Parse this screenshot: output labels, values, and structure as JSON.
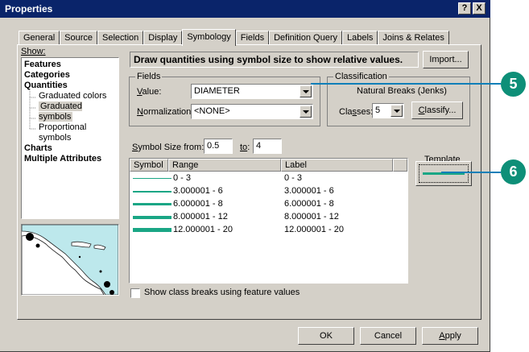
{
  "window": {
    "title": "Properties",
    "help_btn": "?",
    "close_btn": "X"
  },
  "tabs": [
    {
      "label": "General"
    },
    {
      "label": "Source"
    },
    {
      "label": "Selection"
    },
    {
      "label": "Display"
    },
    {
      "label": "Symbology"
    },
    {
      "label": "Fields"
    },
    {
      "label": "Definition Query"
    },
    {
      "label": "Labels"
    },
    {
      "label": "Joins & Relates"
    }
  ],
  "show": {
    "label": "Show:",
    "items": [
      {
        "label": "Features"
      },
      {
        "label": "Categories"
      },
      {
        "label": "Quantities"
      },
      {
        "label": "Graduated colors"
      },
      {
        "label": "Graduated symbols"
      },
      {
        "label": "Proportional symbols"
      },
      {
        "label": "Charts"
      },
      {
        "label": "Multiple Attributes"
      }
    ]
  },
  "description": "Draw quantities using symbol size to show relative values.",
  "import_label": "Import...",
  "fields": {
    "title": "Fields",
    "value_label": "Value:",
    "value": "DIAMETER",
    "normalization_label": "Normalization:",
    "normalization": "<NONE>"
  },
  "classification": {
    "title": "Classification",
    "method": "Natural Breaks (Jenks)",
    "classes_label": "Classes:",
    "classes": "5",
    "classify_label": "Classify..."
  },
  "symbol_size": {
    "from_label": "Symbol Size from:",
    "from": "0.5",
    "to_label": "to:",
    "to": "4"
  },
  "table": {
    "headers": [
      "Symbol",
      "Range",
      "Label"
    ],
    "rows": [
      {
        "range": "0 - 3",
        "label": "0 - 3"
      },
      {
        "range": "3.000001 - 6",
        "label": "3.000001 - 6"
      },
      {
        "range": "6.000001 - 8",
        "label": "6.000001 - 8"
      },
      {
        "range": "8.000001 - 12",
        "label": "8.000001 - 12"
      },
      {
        "range": "12.000001 - 20",
        "label": "12.000001 - 20"
      }
    ]
  },
  "template_label": "Template",
  "show_class_breaks": "Show class breaks using feature values",
  "buttons": {
    "ok": "OK",
    "cancel": "Cancel",
    "apply": "Apply"
  },
  "callouts": [
    "5",
    "6"
  ],
  "colors": {
    "symbol": "#1aa685",
    "callout": "#0e8f78",
    "leader": "#0e7fb8",
    "titlebar": "#0a246a"
  }
}
